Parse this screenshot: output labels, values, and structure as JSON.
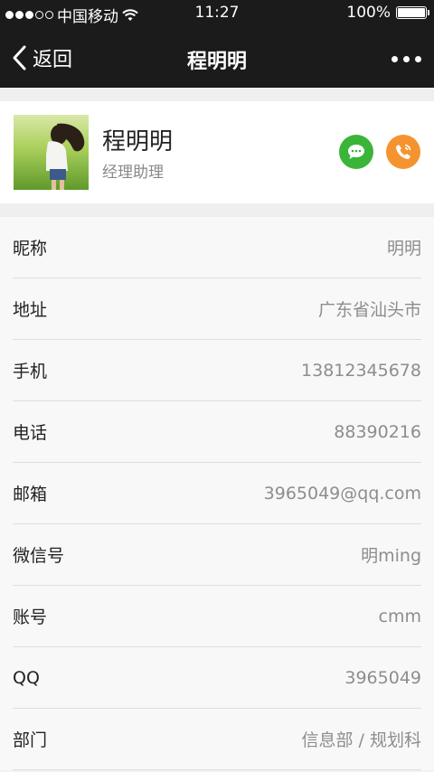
{
  "status_bar": {
    "carrier": "中国移动",
    "time": "11:27",
    "battery": "100%",
    "battery_level": 1.0,
    "signal_bars": 3
  },
  "nav": {
    "back_label": "返回",
    "title": "程明明"
  },
  "profile": {
    "name": "程明明",
    "role": "经理助理"
  },
  "colors": {
    "nav_bg": "#1b1b1b",
    "message_button": "#3bb43a",
    "call_button": "#f5932f"
  },
  "fields": [
    {
      "label": "昵称",
      "value": "明明"
    },
    {
      "label": "地址",
      "value": "广东省汕头市"
    },
    {
      "label": "手机",
      "value": "13812345678"
    },
    {
      "label": "电话",
      "value": "88390216"
    },
    {
      "label": "邮箱",
      "value": "3965049@qq.com"
    },
    {
      "label": "微信号",
      "value": "明ming"
    },
    {
      "label": "账号",
      "value": "cmm"
    },
    {
      "label": "QQ",
      "value": "3965049"
    },
    {
      "label": "部门",
      "value": "信息部 / 规划科"
    }
  ]
}
